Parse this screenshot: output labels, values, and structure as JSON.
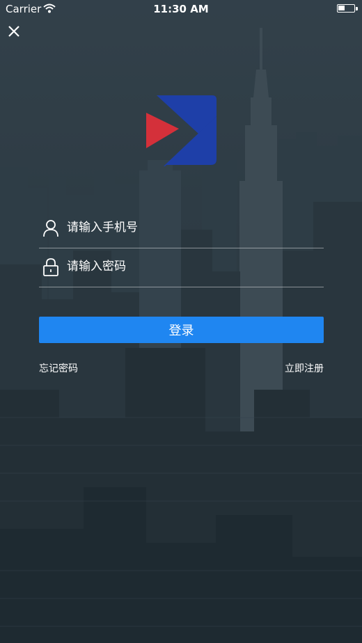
{
  "status_bar": {
    "carrier": "Carrier",
    "time": "11:30 AM",
    "icons": [
      "wifi-icon",
      "battery-icon"
    ]
  },
  "nav": {
    "close_icon": "close-icon"
  },
  "logo": {
    "colors": {
      "left_triangle": "#d4303a",
      "right_shape": "#1e3fa8"
    }
  },
  "form": {
    "phone_placeholder": "请输入手机号",
    "phone_value": "",
    "phone_icon": "user-icon",
    "password_placeholder": "请输入密码",
    "password_value": "",
    "password_icon": "lock-icon"
  },
  "login_button": "登录",
  "links": {
    "forgot_password": "忘记密码",
    "register": "立即注册"
  },
  "colors": {
    "background": "#2f3b44",
    "accent": "#1f86f1",
    "text": "#ffffff"
  }
}
